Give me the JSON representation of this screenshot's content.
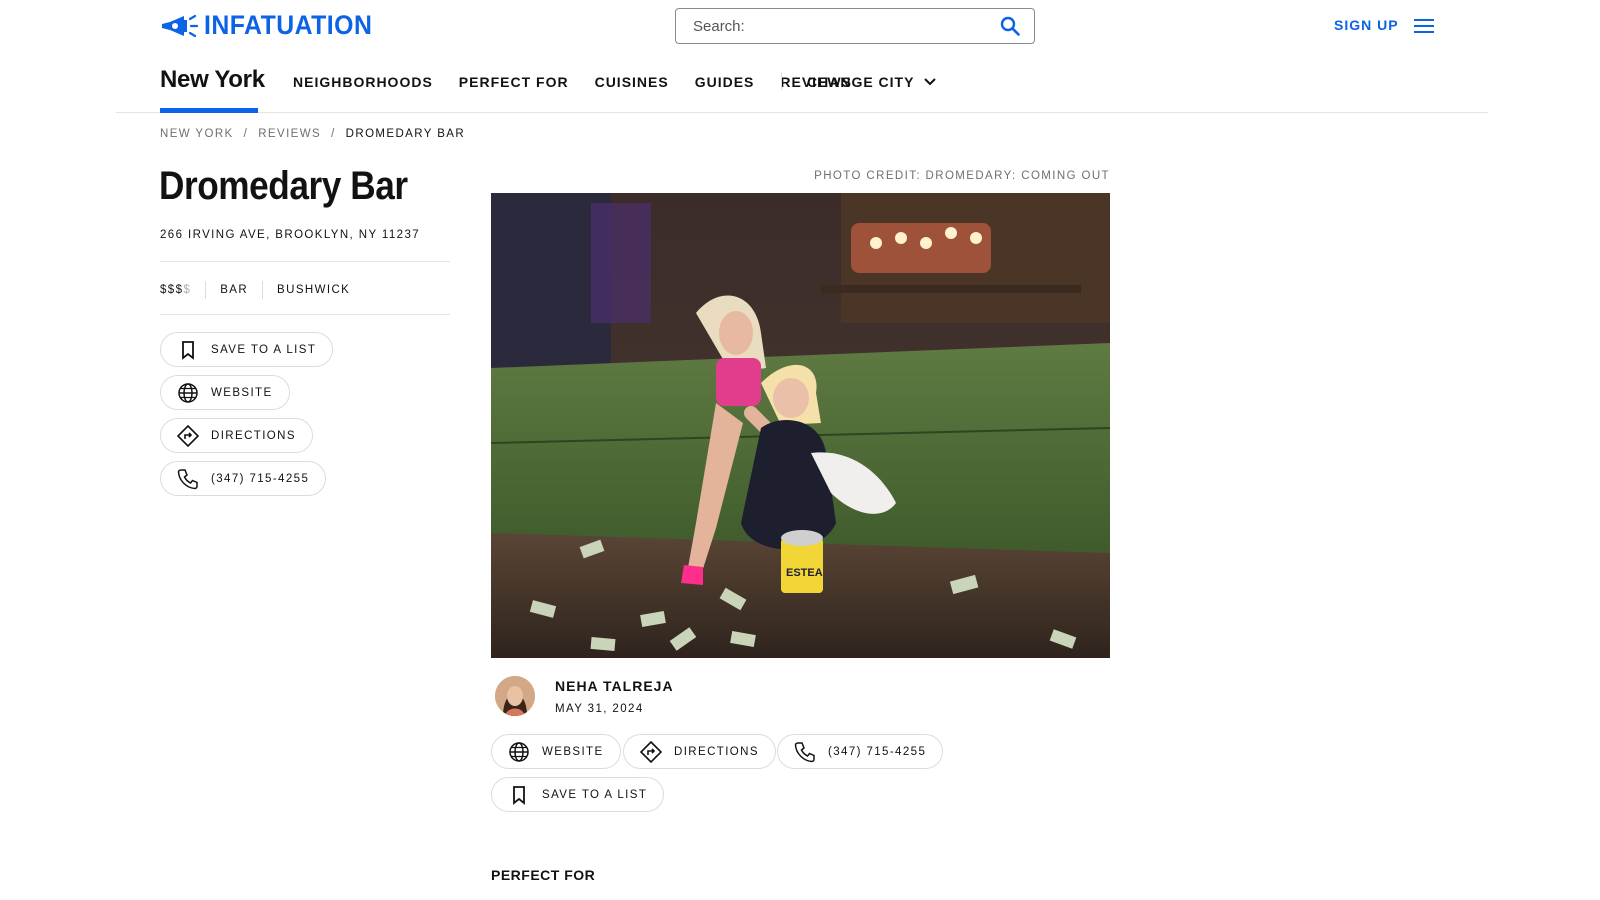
{
  "header": {
    "brand": "INFATUATION",
    "search_placeholder": "Search:",
    "signup_label": "SIGN UP"
  },
  "nav": {
    "city": "New York",
    "links": [
      "NEIGHBORHOODS",
      "PERFECT FOR",
      "CUISINES",
      "GUIDES",
      "REVIEWS"
    ],
    "change_city": "CHANGE CITY"
  },
  "breadcrumb": {
    "items": [
      "NEW YORK",
      "/",
      "REVIEWS",
      "/",
      "DROMEDARY BAR"
    ]
  },
  "venue": {
    "name": "Dromedary Bar",
    "address": "266 IRVING AVE, BROOKLYN, NY 11237",
    "price_active": "$$$",
    "price_inactive": "$",
    "category": "BAR",
    "neighborhood": "BUSHWICK"
  },
  "actions": {
    "save": "SAVE TO A LIST",
    "website": "WEBSITE",
    "directions": "DIRECTIONS",
    "phone": "(347) 715-4255"
  },
  "photo": {
    "credit": "PHOTO CREDIT: DROMEDARY: COMING OUT",
    "bucket_text": "ESTEA"
  },
  "author": {
    "name": "NEHA TALREJA",
    "date": "MAY 31, 2024"
  },
  "section": {
    "perfect_for": "PERFECT FOR"
  },
  "colors": {
    "brand_blue": "#0d63e6",
    "text": "#121212",
    "muted": "#6f6f6f",
    "border": "#dcdcdc"
  },
  "icons": {
    "logo": "megaphone-icon",
    "search": "search-icon",
    "menu": "hamburger-menu-icon",
    "change_city": "chevron-down-icon",
    "save": "bookmark-icon",
    "website": "globe-icon",
    "directions": "directions-sign-icon",
    "phone": "phone-icon"
  }
}
